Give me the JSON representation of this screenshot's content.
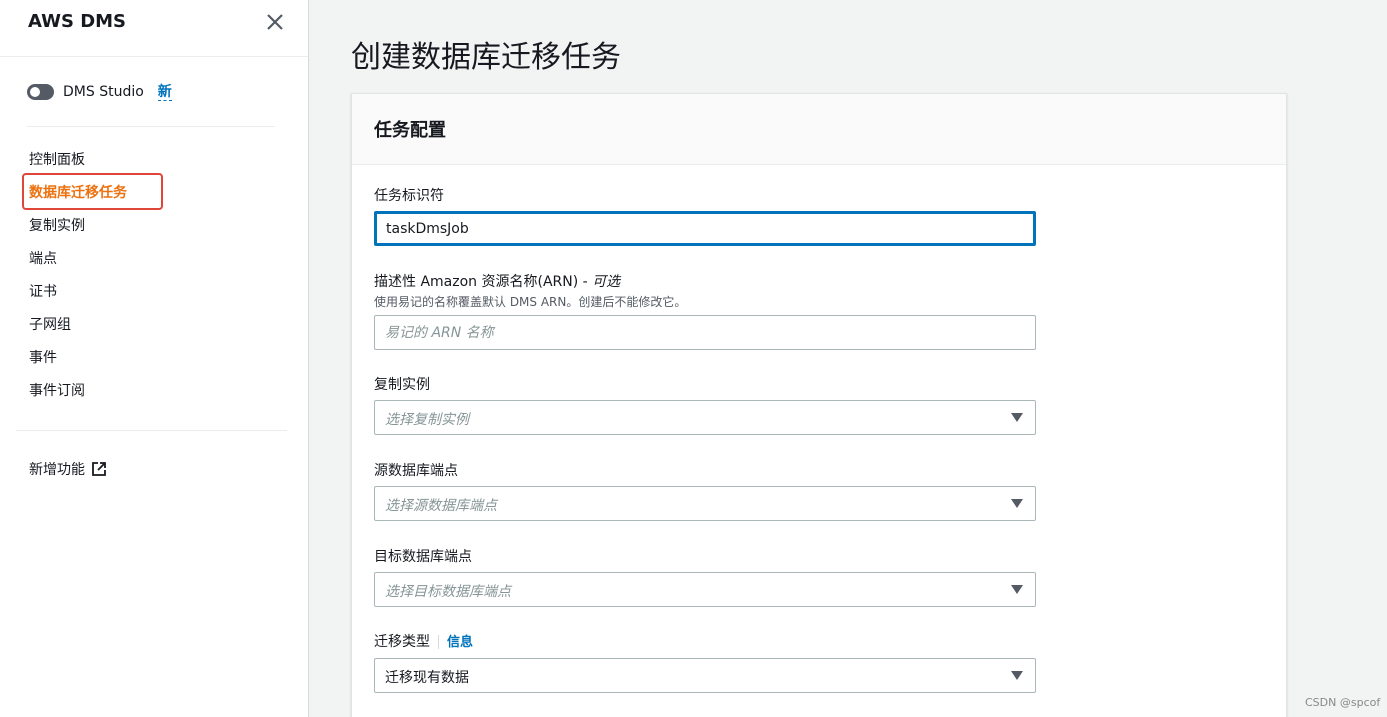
{
  "sidebar": {
    "title": "AWS DMS",
    "studio_label": "DMS Studio",
    "new_badge": "新",
    "nav_items": [
      {
        "label": "控制面板"
      },
      {
        "label": "数据库迁移任务",
        "active": true
      },
      {
        "label": "复制实例"
      },
      {
        "label": "端点"
      },
      {
        "label": "证书"
      },
      {
        "label": "子网组"
      },
      {
        "label": "事件"
      },
      {
        "label": "事件订阅"
      }
    ],
    "whats_new": "新增功能"
  },
  "page": {
    "title": "创建数据库迁移任务"
  },
  "panel": {
    "title": "任务配置",
    "task_identifier": {
      "label": "任务标识符",
      "value": "taskDmsJob"
    },
    "arn": {
      "label": "描述性 Amazon 资源名称(ARN) - ",
      "optional": "可选",
      "description": "使用易记的名称覆盖默认 DMS ARN。创建后不能修改它。",
      "placeholder": "易记的 ARN 名称"
    },
    "replication_instance": {
      "label": "复制实例",
      "placeholder": "选择复制实例"
    },
    "source_endpoint": {
      "label": "源数据库端点",
      "placeholder": "选择源数据库端点"
    },
    "target_endpoint": {
      "label": "目标数据库端点",
      "placeholder": "选择目标数据库端点"
    },
    "migration_type": {
      "label": "迁移类型",
      "info": "信息",
      "value": "迁移现有数据"
    }
  },
  "watermark": "CSDN @spcof",
  "colors": {
    "active_nav": "#ec7211",
    "link": "#0073bb",
    "highlight_box": "#e0453a"
  }
}
